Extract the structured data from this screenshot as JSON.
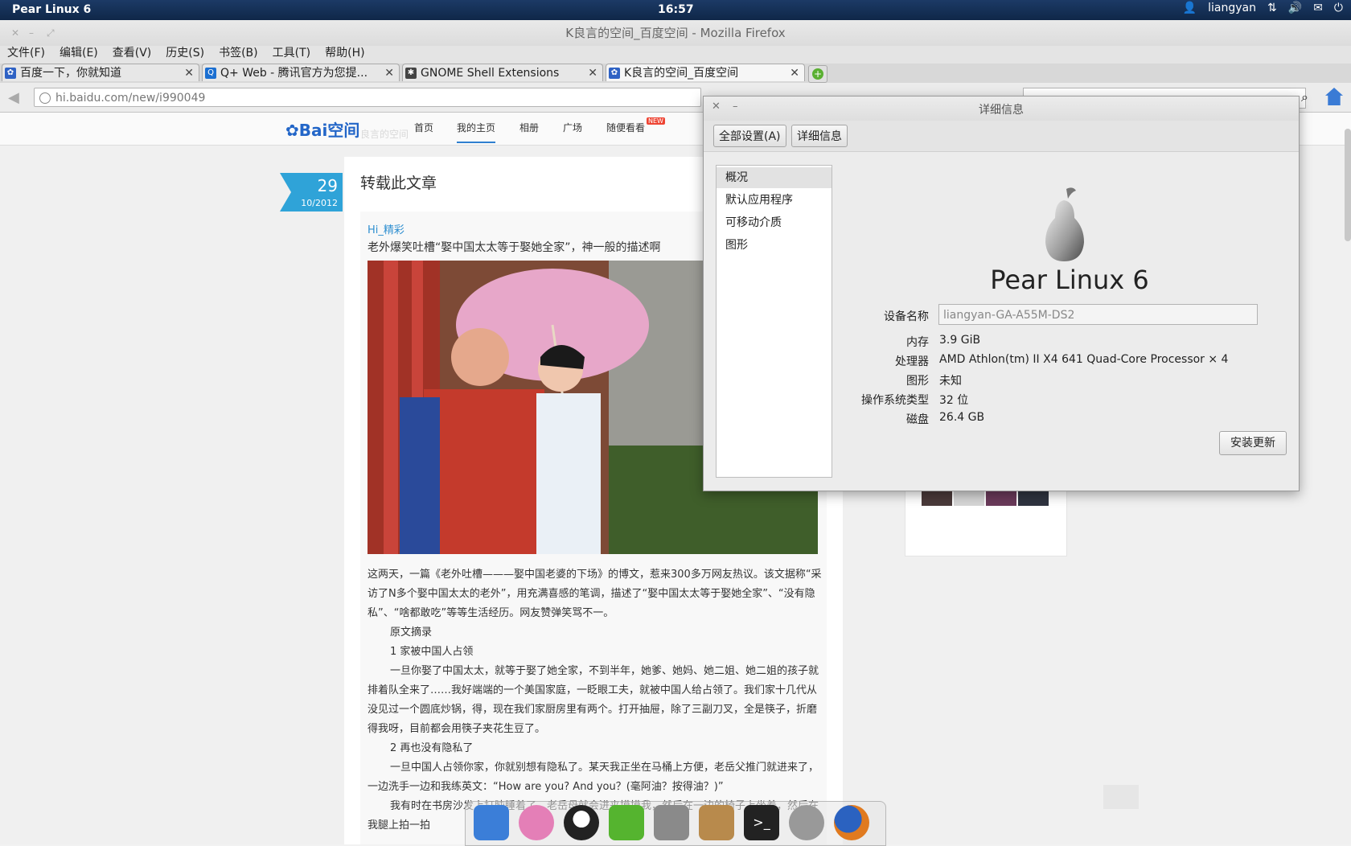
{
  "top_panel": {
    "brand": "Pear Linux 6",
    "clock": "16:57",
    "user": "liangyan",
    "icons": [
      "user-icon",
      "network-icon",
      "volume-icon",
      "mail-icon",
      "power-icon"
    ]
  },
  "window": {
    "title": "K良言的空间_百度空间 - Mozilla Firefox"
  },
  "menubar": {
    "items": [
      "文件(F)",
      "编辑(E)",
      "查看(V)",
      "历史(S)",
      "书签(B)",
      "工具(T)",
      "帮助(H)"
    ]
  },
  "tabs": [
    {
      "title": "百度一下，你就知道",
      "favicon": "baidu-paw-icon",
      "color": "#2f62c4"
    },
    {
      "title": "Q+ Web - 腾讯官方为您提...",
      "favicon": "qq-q-icon",
      "color": "#1b6fd1"
    },
    {
      "title": "GNOME Shell Extensions",
      "favicon": "gnome-foot-icon",
      "color": "#444444"
    },
    {
      "title": "K良言的空间_百度空间",
      "favicon": "baidu-paw-icon",
      "color": "#2f62c4"
    }
  ],
  "navbar": {
    "url": "hi.baidu.com/new/i990049"
  },
  "site": {
    "logo": "Bai空间",
    "logo_sub": "良言的空间",
    "nav": [
      "首页",
      "我的主页",
      "相册",
      "广场",
      "随便看看"
    ],
    "new_badge": "NEW"
  },
  "post": {
    "day": "29",
    "month_year": "10/2012",
    "heading": "转载此文章",
    "author": "Hi_精彩",
    "title": "老外爆笑吐槽“娶中国太太等于娶她全家”，神一般的描述啊",
    "paragraphs": [
      {
        "text": "这两天，一篇《老外吐槽———娶中国老婆的下场》的博文，惹来300多万网友热议。该文据称“采访了N多个娶中国太太的老外”，用充满喜感的笔调，描述了“娶中国太太等于娶她全家”、“没有隐私”、“啥都敢吃”等等生活经历。网友赞弹笑骂不一。",
        "indent": false
      },
      {
        "text": "原文摘录",
        "indent": true
      },
      {
        "text": "1 家被中国人占领",
        "indent": true
      },
      {
        "text": "一旦你娶了中国太太，就等于娶了她全家，不到半年，她爹、她妈、她二姐、她二姐的孩子就排着队全来了……我好端端的一个美国家庭，一眨眼工夫，就被中国人给占领了。我们家十几代从没见过一个圆底炒锅，得，现在我们家厨房里有两个。打开抽屉，除了三副刀叉，全是筷子，折磨得我呀，目前都会用筷子夹花生豆了。",
        "indent": true
      },
      {
        "text": "2 再也没有隐私了",
        "indent": true
      },
      {
        "text": "一旦中国人占领你家，你就别想有隐私了。某天我正坐在马桶上方便，老岳父推门就进来了，一边洗手一边和我练英文：“How are you? And you？(毫阿油？按得油？)”",
        "indent": true
      },
      {
        "text": "我有时在书房沙发上打盹睡着了，老岳母就会进来摸摸我，然后在一边的椅子上坐着，然后在我腿上拍一拍",
        "indent": true
      }
    ]
  },
  "dialog": {
    "title": "详细信息",
    "toolbar": [
      "全部设置(A)",
      "详细信息"
    ],
    "sidebar": [
      "概况",
      "默认应用程序",
      "可移动介质",
      "图形"
    ],
    "os_name": "Pear Linux 6",
    "device_label": "设备名称",
    "device_value": "liangyan-GA-A55M-DS2",
    "rows": [
      {
        "label": "内存",
        "value": "3.9 GiB"
      },
      {
        "label": "处理器",
        "value": "AMD Athlon(tm) II X4 641 Quad-Core Processor × 4"
      },
      {
        "label": "图形",
        "value": "未知"
      },
      {
        "label": "操作系统类型",
        "value": "32 位"
      },
      {
        "label": "磁盘",
        "value": "26.4 GB"
      }
    ],
    "install_button": "安装更新"
  },
  "dock": {
    "items": [
      {
        "name": "finder-dock-icon",
        "color": "#3b7ed8"
      },
      {
        "name": "music-player-dock-icon",
        "color": "#e47fb7"
      },
      {
        "name": "qq-penguin-dock-icon",
        "color": "#222222"
      },
      {
        "name": "feixin-dock-icon",
        "color": "#55b42f"
      },
      {
        "name": "file-manager-dock-icon",
        "color": "#8a8a8a"
      },
      {
        "name": "package-installer-dock-icon",
        "color": "#b88a4c"
      },
      {
        "name": "terminal-dock-icon",
        "color": "#222222"
      },
      {
        "name": "system-settings-dock-icon",
        "color": "#999999"
      },
      {
        "name": "firefox-dock-icon",
        "color": "#e07a1f"
      }
    ]
  }
}
